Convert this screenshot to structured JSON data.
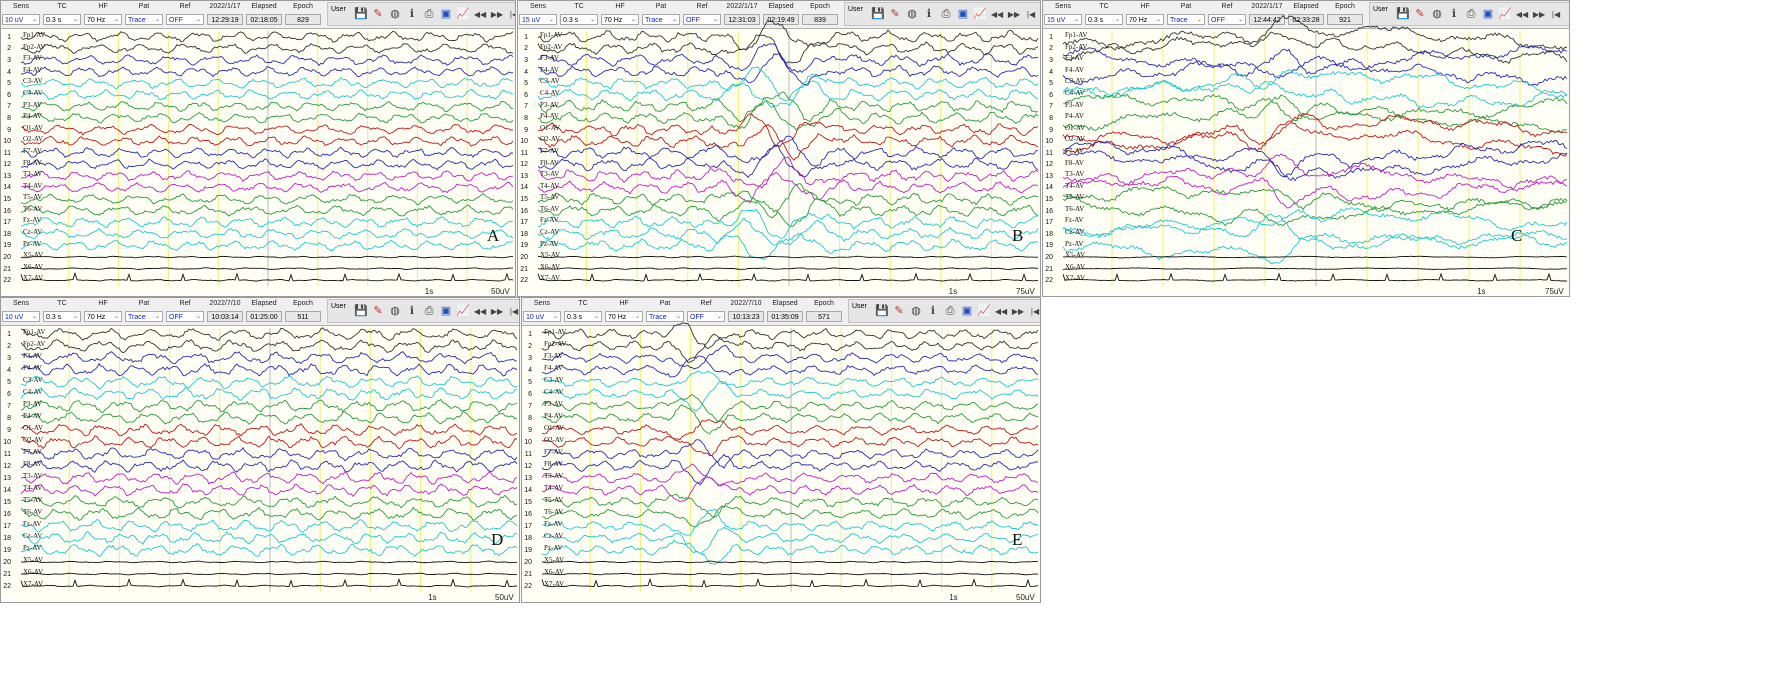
{
  "header_labels": {
    "sens": "Sens",
    "tc": "TC",
    "hf": "HF",
    "pat": "Pat",
    "ref": "Ref",
    "elapsed": "Elapsed",
    "epoch": "Epoch",
    "user": "User"
  },
  "channels": [
    "Fp1-AV",
    "Fp2-AV",
    "F3-AV",
    "F4-AV",
    "C3-AV",
    "C4-AV",
    "P3-AV",
    "P4-AV",
    "O1-AV",
    "O2-AV",
    "F7-AV",
    "F8-AV",
    "T3-AV",
    "T4-AV",
    "T5-AV",
    "T6-AV",
    "Fz-AV",
    "Cz-AV",
    "Pz-AV",
    "X5-AV",
    "X6-AV",
    "X7-AV"
  ],
  "channel_numbers": [
    "1",
    "2",
    "3",
    "4",
    "5",
    "6",
    "7",
    "8",
    "9",
    "10",
    "11",
    "12",
    "13",
    "14",
    "15",
    "16",
    "17",
    "18",
    "19",
    "20",
    "21",
    "22"
  ],
  "channel_colors": [
    "#333333",
    "#333333",
    "#2a2ab0",
    "#2a2ab0",
    "#22c8d0",
    "#22c8d0",
    "#2a9a3a",
    "#2a9a3a",
    "#c01818",
    "#c01818",
    "#2a2ab0",
    "#2a2ab0",
    "#c020c0",
    "#c020c0",
    "#2a9a3a",
    "#2a9a3a",
    "#22c8d0",
    "#22c8d0",
    "#22c8d0",
    "#111111",
    "#111111",
    "#111111"
  ],
  "panels": [
    {
      "id": "A",
      "letter": "A",
      "sens": "10 uV",
      "tc": "0.3 s",
      "hf": "70 Hz",
      "pat": "Trace",
      "ref": "OFF",
      "date": "2022/1/17",
      "time": "12:29:19",
      "elapsed": "02:18:05",
      "epoch": "829",
      "time_scale": "1s",
      "amp_scale": "50uV"
    },
    {
      "id": "B",
      "letter": "B",
      "sens": "15 uV",
      "tc": "0.3 s",
      "hf": "70 Hz",
      "pat": "Trace",
      "ref": "OFF",
      "date": "2022/1/17",
      "time": "12:31:03",
      "elapsed": "02:19:49",
      "epoch": "839",
      "time_scale": "1s",
      "amp_scale": "75uV"
    },
    {
      "id": "C",
      "letter": "C",
      "sens": "15 uV",
      "tc": "0.3 s",
      "hf": "70 Hz",
      "pat": "Trace",
      "ref": "OFF",
      "date": "2022/1/17",
      "time": "12:44:42",
      "elapsed": "02:33:28",
      "epoch": "921",
      "time_scale": "1s",
      "amp_scale": "75uV"
    },
    {
      "id": "D",
      "letter": "D",
      "sens": "10 uV",
      "tc": "0.3 s",
      "hf": "70 Hz",
      "pat": "Trace",
      "ref": "OFF",
      "date": "2022/7/10",
      "time": "10:03:14",
      "elapsed": "01:25:00",
      "epoch": "511",
      "time_scale": "1s",
      "amp_scale": "50uV"
    },
    {
      "id": "E",
      "letter": "E",
      "sens": "10 uV",
      "tc": "0.3 s",
      "hf": "70 Hz",
      "pat": "Trace",
      "ref": "OFF",
      "date": "2022/7/10",
      "time": "10:13:23",
      "elapsed": "01:35:09",
      "epoch": "571",
      "time_scale": "1s",
      "amp_scale": "50uV"
    }
  ]
}
